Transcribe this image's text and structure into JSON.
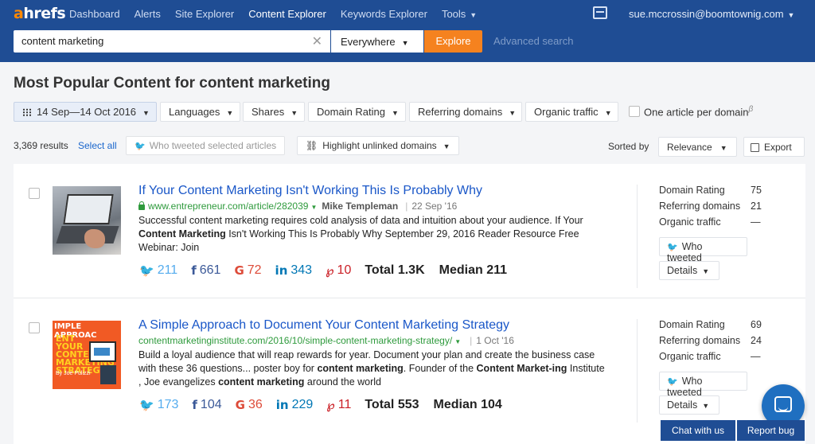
{
  "brand": {
    "logo_a": "a",
    "logo_rest": "hrefs",
    "accent": "#f5821f",
    "nav_bg": "#1f4d94"
  },
  "nav": {
    "items": [
      {
        "label": "Dashboard"
      },
      {
        "label": "Alerts"
      },
      {
        "label": "Site Explorer"
      },
      {
        "label": "Content Explorer",
        "active": true
      },
      {
        "label": "Keywords Explorer"
      },
      {
        "label": "Tools"
      }
    ],
    "user_email": "sue.mccrossin@boomtownig.com"
  },
  "search": {
    "query": "content marketing",
    "scope": "Everywhere",
    "explore_label": "Explore",
    "advanced_label": "Advanced search"
  },
  "page_title": "Most Popular Content for content marketing",
  "filters": {
    "date_range": "14 Sep—14 Oct 2016",
    "languages": "Languages",
    "shares": "Shares",
    "domain_rating": "Domain Rating",
    "referring_domains": "Referring domains",
    "organic_traffic": "Organic traffic",
    "one_per_domain": "One article per domain",
    "beta": "β"
  },
  "results_bar": {
    "count": "3,369 results",
    "select_all": "Select all",
    "who_tweeted_selected": "Who tweeted selected articles",
    "highlight_unlinked": "Highlight unlinked domains",
    "sorted_by_label": "Sorted by",
    "sort_value": "Relevance",
    "export_label": "Export"
  },
  "articles": [
    {
      "title": "If Your Content Marketing Isn't Working This Is Probably Why",
      "url": "www.entrepreneur.com/article/282039",
      "author": "Mike Templeman",
      "date": "22 Sep '16",
      "desc_1": "Successful content marketing requires cold analysis of data and intuition about your audience. If Your ",
      "desc_b1": "Content Marketing",
      "desc_2": " Isn't Working This Is Probably Why September 29, 2016 Reader Resource Free Webinar: Join",
      "twitter": "211",
      "facebook": "661",
      "google": "72",
      "linkedin": "343",
      "pinterest": "10",
      "total": "Total 1.3K",
      "median": "Median 211",
      "dr_label": "Domain Rating",
      "dr": "75",
      "rd_label": "Referring domains",
      "rd": "21",
      "ot_label": "Organic traffic",
      "ot": "—",
      "who_tweeted": "Who tweeted",
      "details": "Details"
    },
    {
      "title": "A Simple Approach to Document Your Content Marketing Strategy",
      "url": "contentmarketinginstitute.com/2016/10/simple-content-marketing-strategy/",
      "author": "",
      "date": "1 Oct '16",
      "desc_1": "Build a loyal audience that will reap rewards for year. Document your plan and create the business case with these 36 questions... poster boy for ",
      "desc_b1": "content marketing",
      "desc_2": ". Founder of the ",
      "desc_b2": "Content Market-ing",
      "desc_3": " Institute , Joe evangelizes ",
      "desc_b3": "content marketing",
      "desc_4": " around the world",
      "twitter": "173",
      "facebook": "104",
      "google": "36",
      "linkedin": "229",
      "pinterest": "11",
      "total": "Total 553",
      "median": "Median 104",
      "dr_label": "Domain Rating",
      "dr": "69",
      "rd_label": "Referring domains",
      "rd": "24",
      "ot_label": "Organic traffic",
      "ot": "—",
      "who_tweeted": "Who tweeted",
      "details": "Details",
      "thumb_line1": "IMPLE APPROAC",
      "thumb_line2": "ENT YOUR CONTENT MARKETING STRATEGY",
      "thumb_by": "By Joe Pulizzi"
    }
  ],
  "footer": {
    "chat": "Chat with us",
    "report": "Report bug"
  }
}
